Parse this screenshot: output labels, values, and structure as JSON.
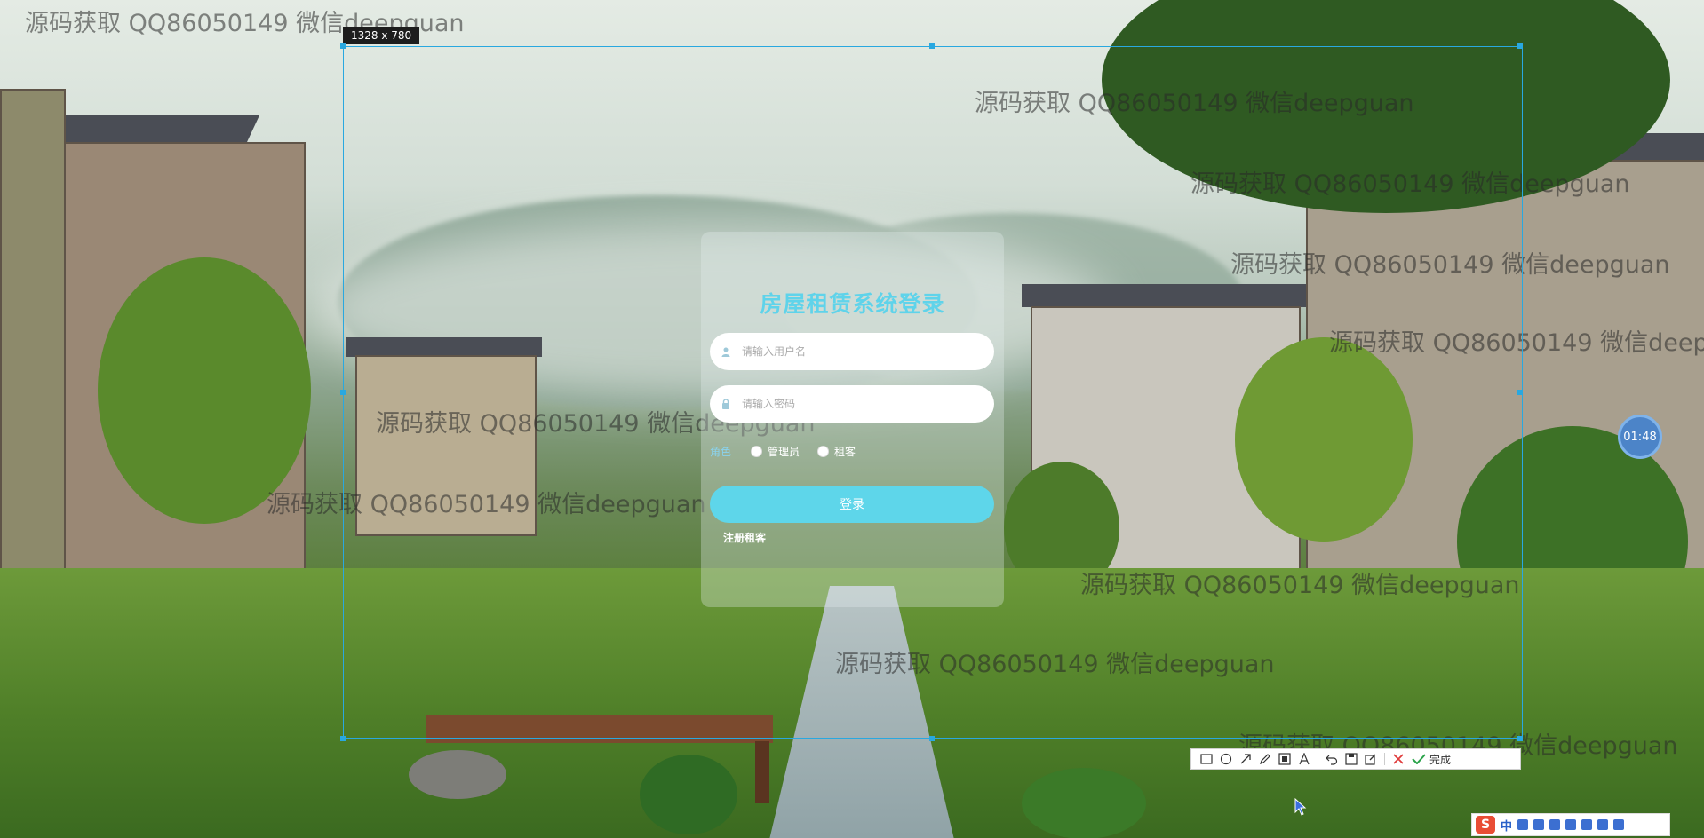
{
  "watermark_text": "源码获取 QQ86050149 微信deepguan",
  "capture": {
    "size_label": "1328 x 780"
  },
  "login": {
    "title": "房屋租赁系统登录",
    "username_placeholder": "请输入用户名",
    "password_placeholder": "请输入密码",
    "role_label": "角色",
    "roles": [
      "管理员",
      "租客"
    ],
    "login_button": "登录",
    "register_link": "注册租客"
  },
  "timer": "01:48",
  "toolbar": {
    "tools": [
      "rectangle-icon",
      "ellipse-icon",
      "arrow-icon",
      "pen-icon",
      "mosaic-icon",
      "text-icon",
      "undo-icon",
      "save-icon",
      "edit-icon"
    ],
    "cancel": "close-icon",
    "done_label": "完成"
  },
  "ime": {
    "logo": "S",
    "mode": "中"
  },
  "colors": {
    "accent": "#5ed6ea",
    "title": "#5fd3ea",
    "selection": "#29a8e0"
  }
}
